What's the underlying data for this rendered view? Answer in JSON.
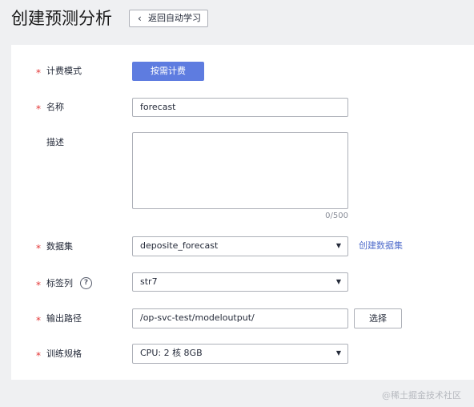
{
  "header": {
    "title": "创建预测分析",
    "back_label": "返回自动学习"
  },
  "form": {
    "billing_mode": {
      "label": "计费模式",
      "button": "按需计费"
    },
    "name": {
      "label": "名称",
      "value": "forecast"
    },
    "description": {
      "label": "描述",
      "value": "",
      "counter": "0/500"
    },
    "dataset": {
      "label": "数据集",
      "value": "deposite_forecast",
      "link": "创建数据集"
    },
    "label_column": {
      "label": "标签列",
      "value": "str7"
    },
    "output_path": {
      "label": "输出路径",
      "value": "/op-svc-test/modeloutput/",
      "button": "选择"
    },
    "training_spec": {
      "label": "训练规格",
      "value": "CPU: 2 核 8GB"
    },
    "required_marker": "*"
  },
  "icons": {
    "back": "chevron-left-icon",
    "dropdown": "caret-down-icon",
    "help": "question-circle-icon"
  },
  "colors": {
    "primary": "#5e7ce0",
    "link": "#526ecc",
    "required": "#e33535",
    "background": "#eff0f2"
  },
  "watermark": "@稀土掘金技术社区"
}
